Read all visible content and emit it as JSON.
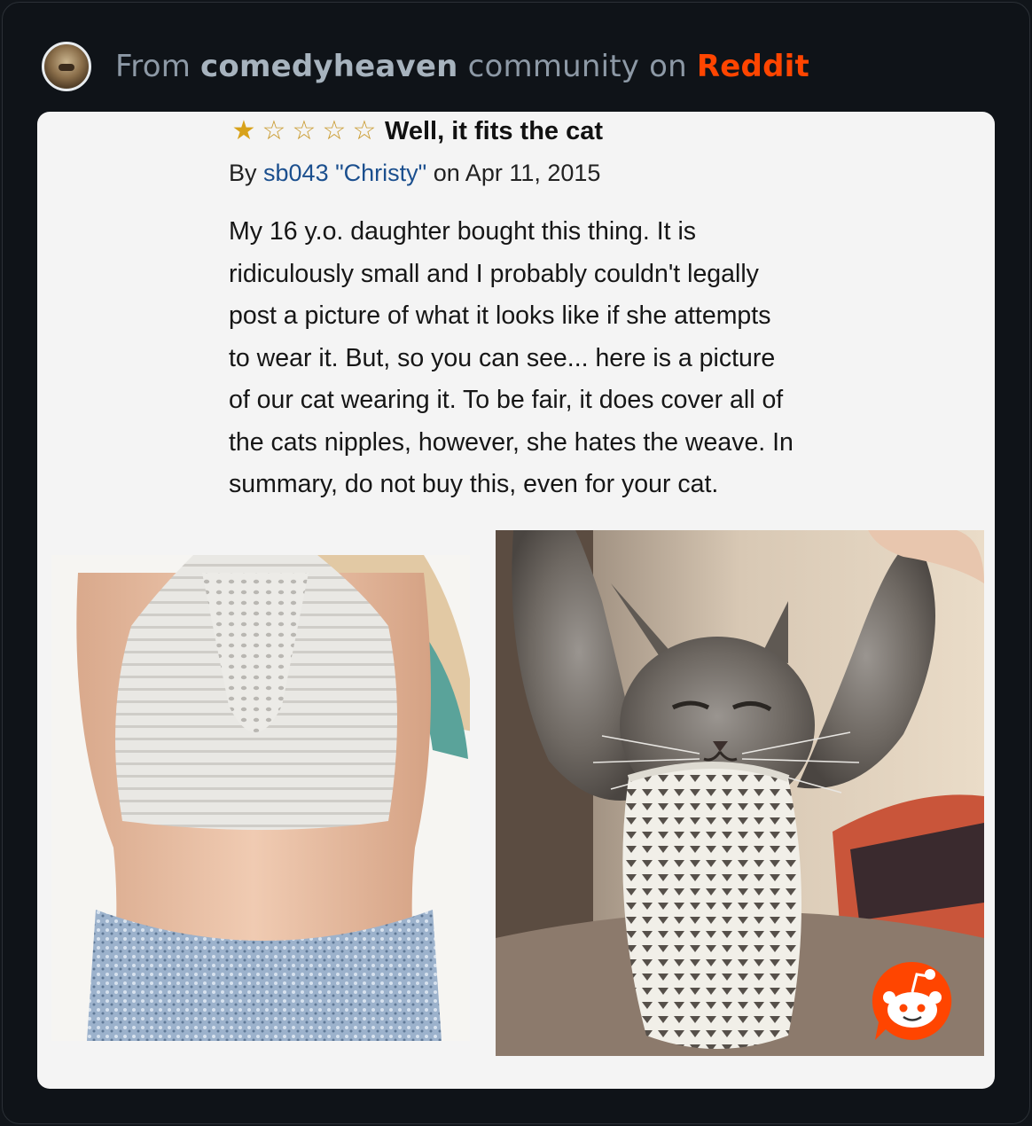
{
  "header": {
    "prefix": "From ",
    "community": "comedyheaven",
    "middle": " community on ",
    "platform": "Reddit"
  },
  "review": {
    "rating": 1,
    "max_rating": 5,
    "title": "Well, it fits the cat",
    "by_prefix": "By ",
    "author": "sb043 \"Christy\"",
    "date": " on Apr 11, 2015",
    "body_lines": [
      "My 16 y.o. daughter bought this thing. It is",
      "ridiculously small and I probably couldn't legally",
      "post a picture of what it looks like if she attempts",
      "to wear it. But, so you can see... here is a picture",
      "of our cat wearing it. To be fair, it does cover all of",
      "the cats nipples, however, she hates the weave. In",
      "summary, do not buy this, even for your cat."
    ]
  },
  "colors": {
    "reddit_orange": "#ff4500",
    "star_gold": "#d8a21a",
    "author_link": "#1b4f8e",
    "background": "#11151a"
  },
  "icons": {
    "avatar": "community-avatar",
    "badge": "reddit-snoo-icon"
  }
}
